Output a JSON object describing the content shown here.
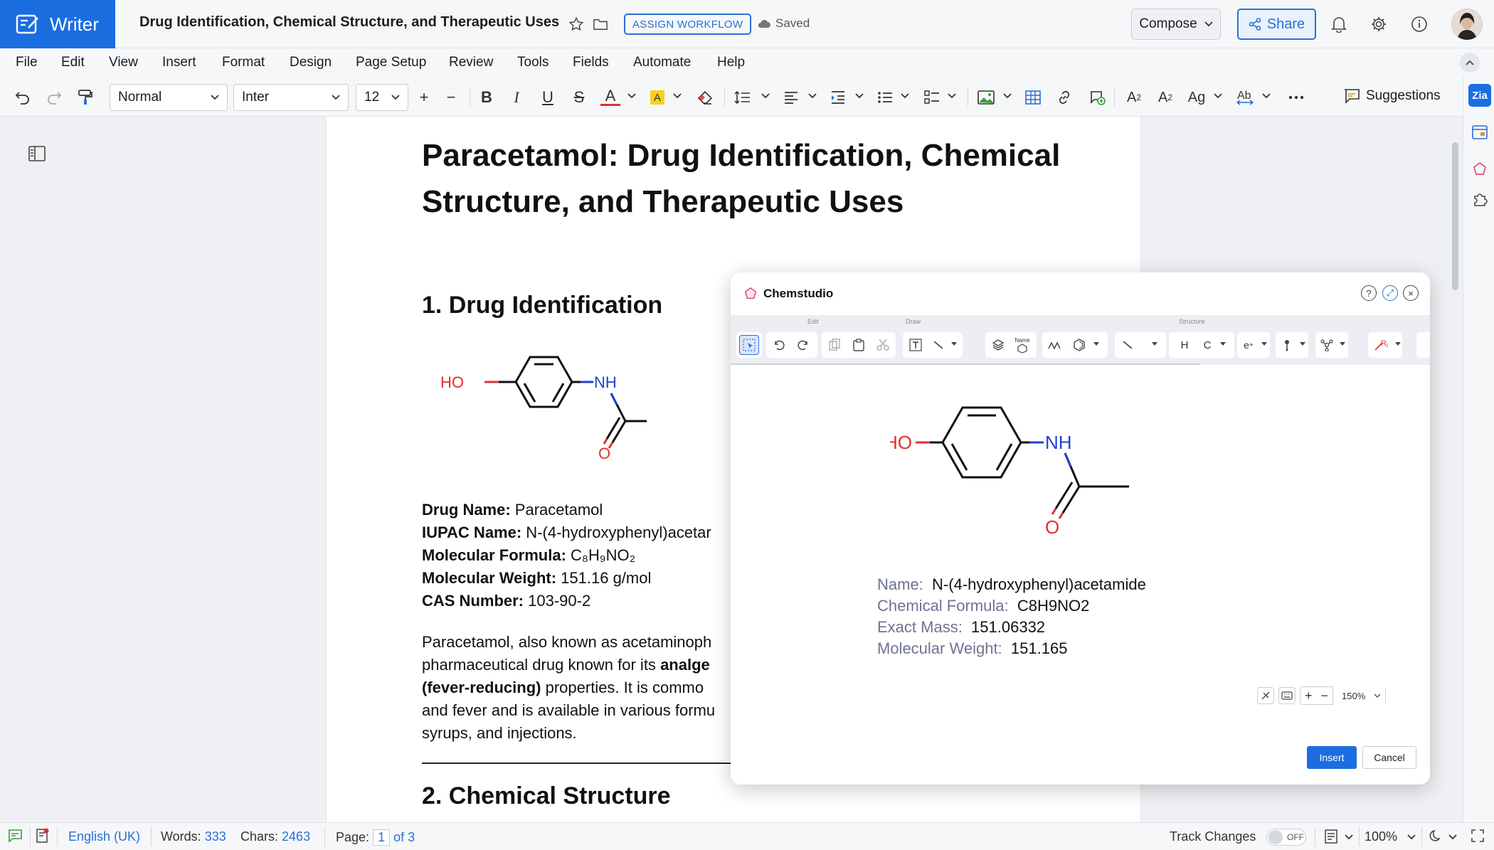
{
  "app": {
    "name": "Writer",
    "brand_color": "#1a6ee0"
  },
  "header": {
    "doc_title": "Drug Identification, Chemical Structure, and Therapeutic Uses",
    "workflow_label": "ASSIGN WORKFLOW",
    "saved_label": "Saved",
    "compose_label": "Compose",
    "share_label": "Share"
  },
  "menu": [
    "File",
    "Edit",
    "View",
    "Insert",
    "Format",
    "Design",
    "Page Setup",
    "Review",
    "Tools",
    "Fields",
    "Automate",
    "Help"
  ],
  "toolbar": {
    "style_value": "Normal",
    "font_value": "Inter",
    "size_value": "12",
    "suggestions_label": "Suggestions"
  },
  "document": {
    "title": "Paracetamol: Drug Identification, Chemical Structure, and Therapeutic Uses",
    "section1": "1. Drug Identification",
    "facts": [
      {
        "label": "Drug Name:",
        "value": " Paracetamol"
      },
      {
        "label": "IUPAC Name:",
        "value": " N-(4-hydroxyphenyl)acetar"
      },
      {
        "label": "Molecular Formula:",
        "value": " C₈H₉NO₂"
      },
      {
        "label": "Molecular Weight:",
        "value": " 151.16 g/mol"
      },
      {
        "label": "CAS Number:",
        "value": " 103-90-2"
      }
    ],
    "para": {
      "l1": "Paracetamol, also known as acetaminoph",
      "l2a": "pharmaceutical drug known for its ",
      "l2b": "analge",
      "l3a": "(fever-reducing)",
      "l3b": " properties. It is commo",
      "l4": "and fever and is available in various formu",
      "l5": "syrups, and injections."
    },
    "section2": "2. Chemical Structure",
    "structure_labels": {
      "ho": "HO",
      "nh": "NH",
      "o": "O"
    }
  },
  "status": {
    "language": "English (UK)",
    "words_label": "Words:",
    "words": "333",
    "chars_label": "Chars:",
    "chars": "2463",
    "page_label": "Page:",
    "page_current": "1",
    "page_total": "of 3",
    "track_label": "Track Changes",
    "track_state": "OFF",
    "zoom": "100%"
  },
  "chemstudio": {
    "title": "Chemstudio",
    "groups": [
      "Edit",
      "Draw",
      "Structure"
    ],
    "tool_h": "H",
    "tool_c": "C",
    "tool_name": "Name",
    "info": [
      {
        "key": "Name:",
        "value": "N-(4-hydroxyphenyl)acetamide"
      },
      {
        "key": "Chemical Formula:",
        "value": "C8H9NO2"
      },
      {
        "key": "Exact Mass:",
        "value": "151.06332"
      },
      {
        "key": "Molecular Weight:",
        "value": "151.165"
      }
    ],
    "zoom": "150%",
    "insert_label": "Insert",
    "cancel_label": "Cancel",
    "structure_labels": {
      "ho": "HO",
      "nh": "NH",
      "o": "O"
    }
  }
}
